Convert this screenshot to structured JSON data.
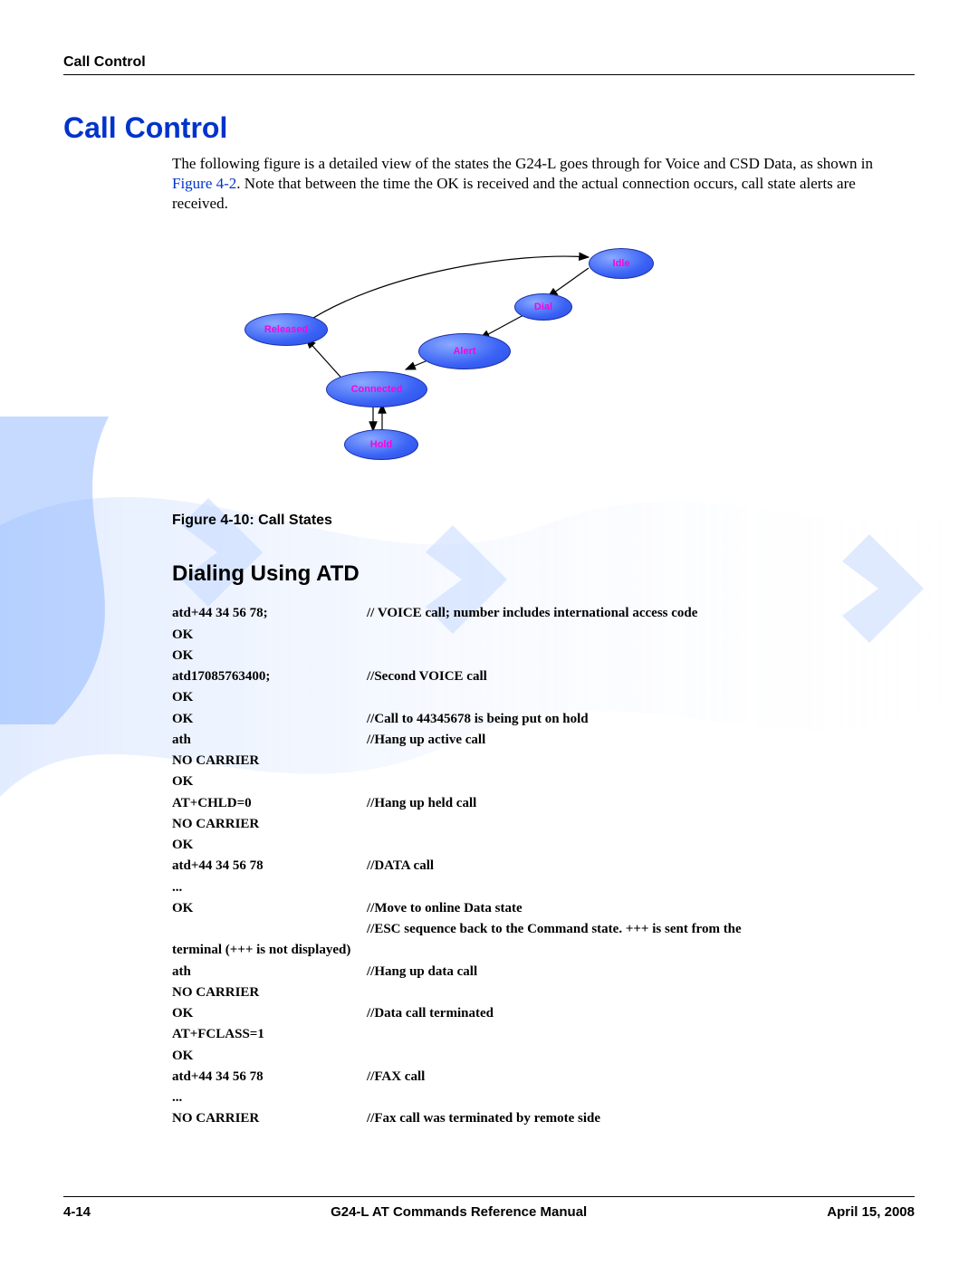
{
  "header": {
    "title": "Call Control"
  },
  "main_heading": "Call Control",
  "intro": {
    "part1": "The following figure is a detailed view of the states the G24-L goes through for Voice and CSD Data, as shown in ",
    "link": "Figure 4-2",
    "part2": ". Note that between the time the OK is received and the actual connection occurs, call state alerts are received."
  },
  "diagram": {
    "nodes": {
      "idle": "Idle",
      "dial": "Dial",
      "released": "Released",
      "alert": "Alert",
      "connected": "Connected",
      "hold": "Hold"
    }
  },
  "figure_caption": "Figure 4-10: Call States",
  "sub_heading": "Dialing Using ATD",
  "code": [
    {
      "l": "atd+44 34 56 78;",
      "r": "// VOICE call; number includes international access code"
    },
    {
      "l": "OK",
      "r": ""
    },
    {
      "l": "OK",
      "r": ""
    },
    {
      "l": "atd17085763400;",
      "r": "//Second VOICE call"
    },
    {
      "l": "OK",
      "r": ""
    },
    {
      "l": "OK",
      "r": "//Call to 44345678 is being put on hold"
    },
    {
      "l": "ath",
      "r": "//Hang up active call"
    },
    {
      "l": "NO CARRIER",
      "r": ""
    },
    {
      "l": "OK",
      "r": ""
    },
    {
      "l": "AT+CHLD=0",
      "r": "//Hang up held call"
    },
    {
      "l": "NO CARRIER",
      "r": ""
    },
    {
      "l": "OK",
      "r": ""
    },
    {
      "l": "atd+44 34 56 78",
      "r": "//DATA call"
    },
    {
      "l": "...",
      "r": ""
    },
    {
      "l": "OK",
      "r": "//Move to online Data state"
    },
    {
      "l": "",
      "r": "//ESC sequence back to the Command state. +++ is sent from the "
    },
    {
      "l": "terminal (+++ is not displayed)",
      "r": ""
    },
    {
      "l": "ath",
      "r": "//Hang up data call"
    },
    {
      "l": "NO CARRIER",
      "r": ""
    },
    {
      "l": "OK",
      "r": "//Data call terminated"
    },
    {
      "l": "AT+FCLASS=1",
      "r": ""
    },
    {
      "l": "OK",
      "r": ""
    },
    {
      "l": "atd+44 34 56 78",
      "r": "//FAX call"
    },
    {
      "l": "...",
      "r": ""
    },
    {
      "l": "NO CARRIER",
      "r": "//Fax call was terminated by remote side"
    }
  ],
  "footer": {
    "page": "4-14",
    "manual": "G24-L AT Commands Reference Manual",
    "date": "April 15, 2008"
  }
}
